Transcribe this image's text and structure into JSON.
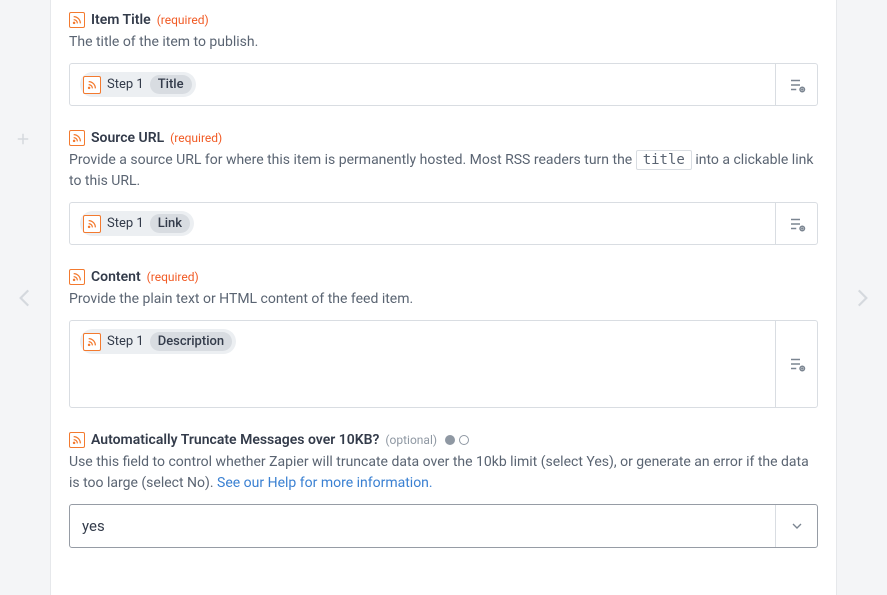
{
  "labels": {
    "required": "(required)",
    "optional": "(optional)"
  },
  "pill": {
    "step": "Step",
    "stepNum": "1"
  },
  "fields": [
    {
      "key": "item_title",
      "label": "Item Title",
      "required": true,
      "help": "The title of the item to publish.",
      "pillFieldLabel": "Title",
      "tall": false
    },
    {
      "key": "source_url",
      "label": "Source URL",
      "required": true,
      "help_prefix": "Provide a source URL for where this item is permanently hosted. Most RSS readers turn the ",
      "help_code": "title",
      "help_suffix": " into a clickable link to this URL.",
      "pillFieldLabel": "Link",
      "tall": false
    },
    {
      "key": "content",
      "label": "Content",
      "required": true,
      "help": "Provide the plain text or HTML content of the feed item.",
      "pillFieldLabel": "Description",
      "tall": true
    }
  ],
  "truncate": {
    "label": "Automatically Truncate Messages over 10KB?",
    "help_text": "Use this field to control whether Zapier will truncate data over the 10kb limit (select Yes), or generate an error if the data is too large (select No). ",
    "help_link_text": "See our Help for more information.",
    "value": "yes"
  }
}
